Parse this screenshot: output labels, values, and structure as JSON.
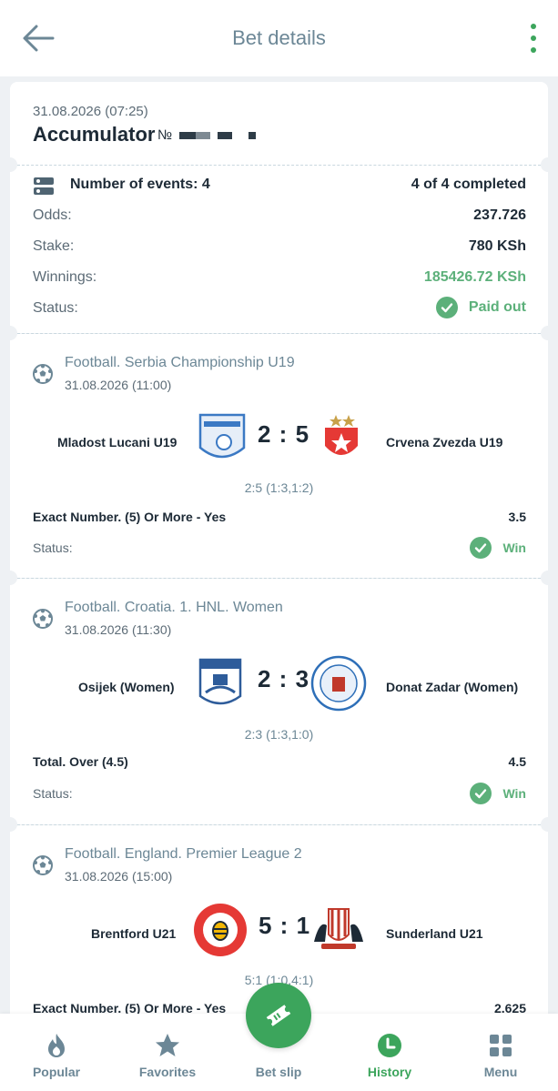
{
  "header": {
    "title": "Bet details"
  },
  "summary": {
    "datetime": "31.08.2026 (07:25)",
    "type": "Accumulator",
    "number_prefix": "№",
    "events_label": "Number of events: 4",
    "events_progress": "4 of 4 completed",
    "odds_label": "Odds:",
    "odds_value": "237.726",
    "stake_label": "Stake:",
    "stake_value": "780 KSh",
    "winnings_label": "Winnings:",
    "winnings_value": "185426.72 KSh",
    "status_label": "Status:",
    "status_value": "Paid out"
  },
  "events": [
    {
      "league": "Football. Serbia Championship U19",
      "datetime": "31.08.2026 (11:00)",
      "home": "Mladost Lucani U19",
      "away": "Crvena Zvezda U19",
      "score": "2 : 5",
      "halves": "2:5 (1:3,1:2)",
      "market": "Exact Number. (5) Or More - Yes",
      "odd": "3.5",
      "status_label": "Status:",
      "status_value": "Win"
    },
    {
      "league": "Football. Croatia. 1. HNL. Women",
      "datetime": "31.08.2026 (11:30)",
      "home": "Osijek (Women)",
      "away": "Donat Zadar (Women)",
      "score": "2 : 3",
      "halves": "2:3 (1:3,1:0)",
      "market": "Total. Over (4.5)",
      "odd": "4.5",
      "status_label": "Status:",
      "status_value": "Win"
    },
    {
      "league": "Football. England. Premier League 2",
      "datetime": "31.08.2026 (15:00)",
      "home": "Brentford U21",
      "away": "Sunderland U21",
      "score": "5 : 1",
      "halves": "5:1 (1:0,4:1)",
      "market": "Exact Number. (5) Or More - Yes",
      "odd": "2.625"
    }
  ],
  "nav": {
    "popular": "Popular",
    "favorites": "Favorites",
    "betslip": "Bet slip",
    "history": "History",
    "menu": "Menu"
  },
  "colors": {
    "accent": "#3ca55c",
    "win": "#5cb07a",
    "muted": "#6c8796"
  }
}
